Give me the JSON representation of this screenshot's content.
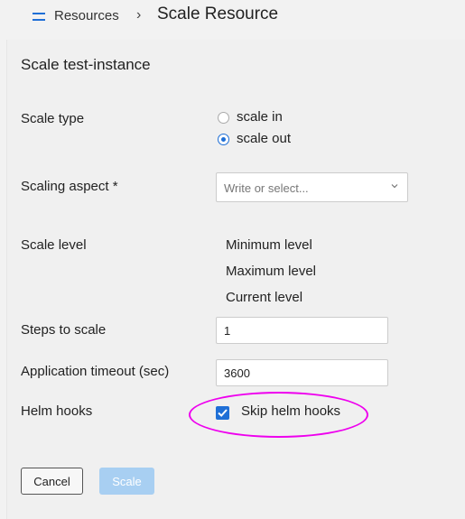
{
  "breadcrumb": {
    "parent_label": "Resources",
    "separator": "›",
    "title": "Scale Resource"
  },
  "form": {
    "heading": "Scale test-instance",
    "scale_type": {
      "label": "Scale type",
      "options": [
        {
          "label": "scale in",
          "selected": false
        },
        {
          "label": "scale out",
          "selected": true
        }
      ]
    },
    "scaling_aspect": {
      "label": "Scaling aspect *",
      "placeholder": "Write or select..."
    },
    "scale_level": {
      "label": "Scale level",
      "items": [
        "Minimum level",
        "Maximum level",
        "Current level"
      ]
    },
    "steps_to_scale": {
      "label": "Steps to scale",
      "value": "1"
    },
    "application_timeout": {
      "label": "Application timeout (sec)",
      "value": "3600"
    },
    "helm_hooks": {
      "label": "Helm hooks",
      "checkbox_label": "Skip helm hooks",
      "checked": true
    }
  },
  "buttons": {
    "cancel": "Cancel",
    "scale": "Scale"
  },
  "colors": {
    "accent": "#1f6fd6",
    "disabled_button": "#a8cff2",
    "highlight": "#ee00ee"
  }
}
